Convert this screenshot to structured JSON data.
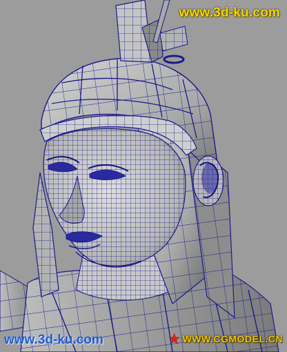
{
  "watermarks": {
    "top": "www.3d-ku.com",
    "bottom_left": "www.3d-ku.com",
    "bottom_right": "WWW.CGMODEL.CN"
  },
  "colors": {
    "viewport_background": "#9c9c9c",
    "wireframe": "#1a1a8c",
    "surface_light": "#d8d8d8",
    "surface_shadow": "#6e6e6e"
  }
}
